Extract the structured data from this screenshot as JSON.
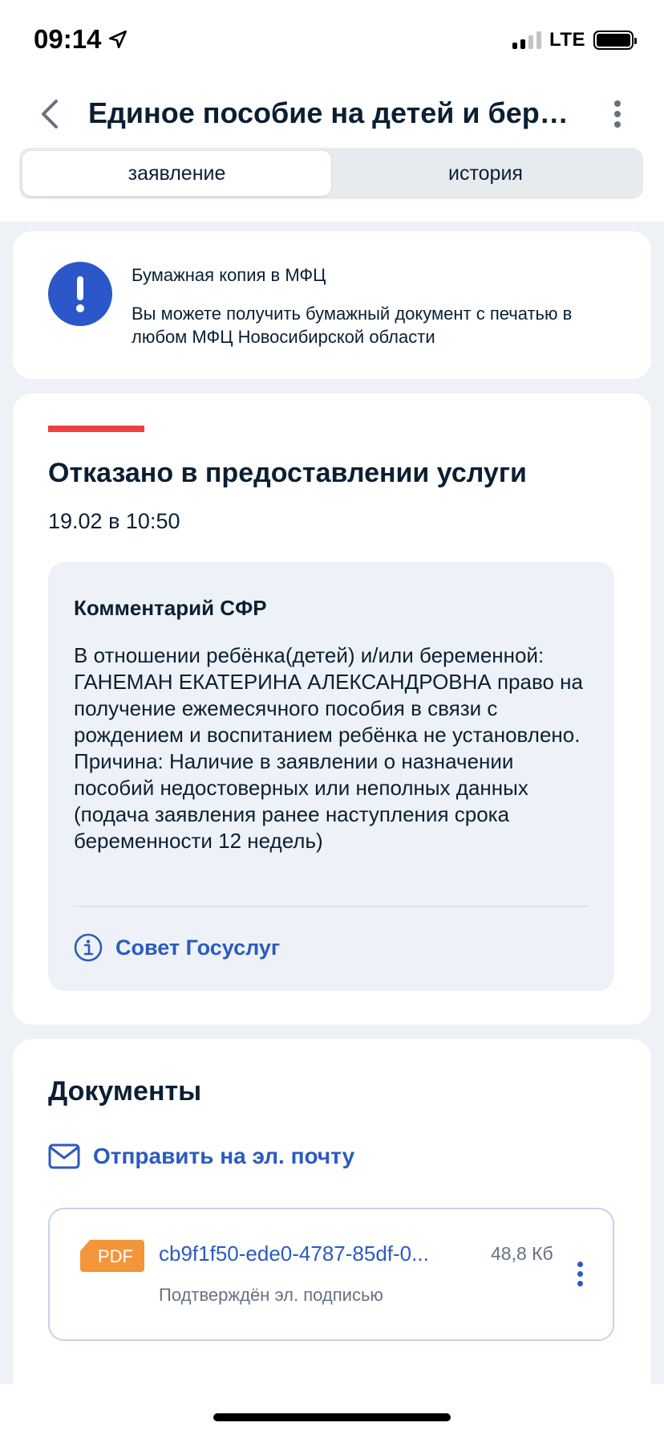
{
  "status_bar": {
    "time": "09:14",
    "network": "LTE"
  },
  "header": {
    "title": "Единое пособие на детей и бере...",
    "tabs": [
      {
        "label": "заявление",
        "active": true
      },
      {
        "label": "история",
        "active": false
      }
    ]
  },
  "info_card": {
    "icon": "alert-icon",
    "title": "Бумажная копия в МФЦ",
    "text": "Вы можете получить бумажный документ с печатью в любом МФЦ Новосибирской области"
  },
  "status_card": {
    "heading": "Отказано в предоставлении услуги",
    "date": "19.02 в 10:50",
    "comment_title": "Комментарий СФР",
    "comment_text": "В отношении ребёнка(детей) и/или беременной: ГАНЕМАН ЕКАТЕРИНА АЛЕКСАНДРОВНА право на получение ежемесячного пособия в связи с рождением и воспитанием ребёнка не установлено. Причина: Наличие в заявлении о назначении пособий недостоверных или неполных данных (подача заявления ранее наступления срока беременности 12 недель)",
    "advice_label": "Совет Госуслуг"
  },
  "documents": {
    "heading": "Документы",
    "email_label": "Отправить на эл. почту",
    "files": [
      {
        "type": "PDF",
        "name": "cb9f1f50-ede0-4787-85df-0...",
        "size": "48,8 Кб",
        "status": "Подтверждён эл. подписью"
      }
    ]
  },
  "colors": {
    "primary": "#2b5bbf",
    "alert_bg": "#2b57c8",
    "denied_accent": "#ee3f3f",
    "pdf_badge": "#f3963a",
    "page_bg": "#eef1f6"
  }
}
